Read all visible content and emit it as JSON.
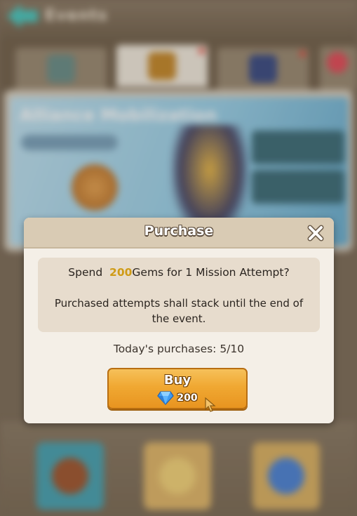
{
  "background": {
    "screen_title": "Events",
    "banner_title": "Alliance Mobilization"
  },
  "dialog": {
    "title": "Purchase",
    "spend_prefix": "Spend",
    "gem_amount": "200",
    "spend_suffix": "Gems for 1 Mission Attempt?",
    "note": "Purchased attempts shall stack until the end of the event.",
    "todays_purchases": "Today's purchases: 5/10",
    "buy_label": "Buy",
    "buy_cost": "200"
  },
  "icons": {
    "close": "close-x-icon",
    "gem": "diamond-gem-icon",
    "cursor": "mouse-pointer-icon"
  },
  "colors": {
    "gem_amount_accent": "#cf9b16",
    "buy_button": "#f0a832",
    "dialog_header": "#d9cbb4",
    "info_box": "#e7dccd"
  }
}
